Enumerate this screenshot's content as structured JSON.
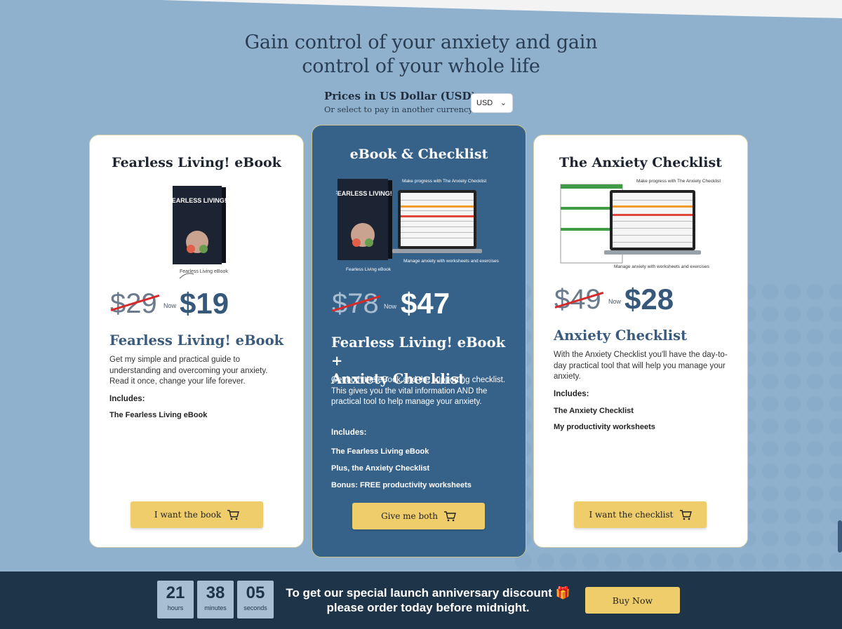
{
  "headline": {
    "line1": "Gain control of your anxiety and gain",
    "line2": "control of your whole life"
  },
  "currency": {
    "title": "Prices in US Dollar (USD)",
    "subtitle": "Or select to pay in another currency",
    "selected": "USD"
  },
  "cards": [
    {
      "title": "Fearless Living! eBook",
      "image_caption": "Fearless Living eBook",
      "book_cover": "FEARLESS LIVING!",
      "old_price": "$29",
      "now_label": "Now",
      "new_price": "$19",
      "product_name": "Fearless Living! eBook",
      "description": "Get my simple and practical guide to understanding and overcoming your anxiety. Read it once, change your life forever.",
      "includes_label": "Includes:",
      "includes": [
        "The Fearless Living eBook"
      ],
      "button_label": "I want the book"
    },
    {
      "title": "eBook & Checklist",
      "image_caption_top": "Make progress with The Anxiety Checklist",
      "image_caption_bottom": "Manage anxiety with worksheets and exercises",
      "image_caption": "Fearless Living eBook",
      "book_cover": "FEARLESS LIVING!",
      "old_price": "$78",
      "now_label": "Now",
      "new_price": "$47",
      "product_name_line1": "Fearless Living! eBook +",
      "product_name_line2": "Anxiety Checklist",
      "description": "Get both the eBook and the supporting checklist. This gives you the vital information AND the practical tool to help manage your anxiety.",
      "includes_label": "Includes:",
      "includes": [
        "The Fearless Living eBook",
        "Plus, the Anxiety Checklist",
        "Bonus: FREE productivity worksheets"
      ],
      "button_label": "Give me both"
    },
    {
      "title": "The Anxiety Checklist",
      "image_caption_top": "Make progress with The Anxiety Checklist",
      "image_caption_bottom": "Manage anxiety with worksheets and exercises",
      "old_price": "$49",
      "now_label": "Now",
      "new_price": "$28",
      "product_name": "Anxiety Checklist",
      "description": "With the Anxiety Checklist you'll have the day-to-day practical tool that will help you manage your anxiety.",
      "includes_label": "Includes:",
      "includes": [
        "The Anxiety Checklist",
        "My productivity worksheets"
      ],
      "button_label": "I want the checklist"
    }
  ],
  "countdown": {
    "hours": "21",
    "hours_label": "hours",
    "minutes": "38",
    "minutes_label": "minutes",
    "seconds": "05",
    "seconds_label": "seconds"
  },
  "promo": {
    "line1": "To get our special launch anniversary discount 🎁",
    "line2": "please order today before midnight."
  },
  "buy_now_label": "Buy Now",
  "colors": {
    "background": "#8fb1ce",
    "dark_card": "#36628a",
    "button": "#f0cd6b",
    "bottom_bar": "#1e3448",
    "strike": "#d62a2a"
  }
}
